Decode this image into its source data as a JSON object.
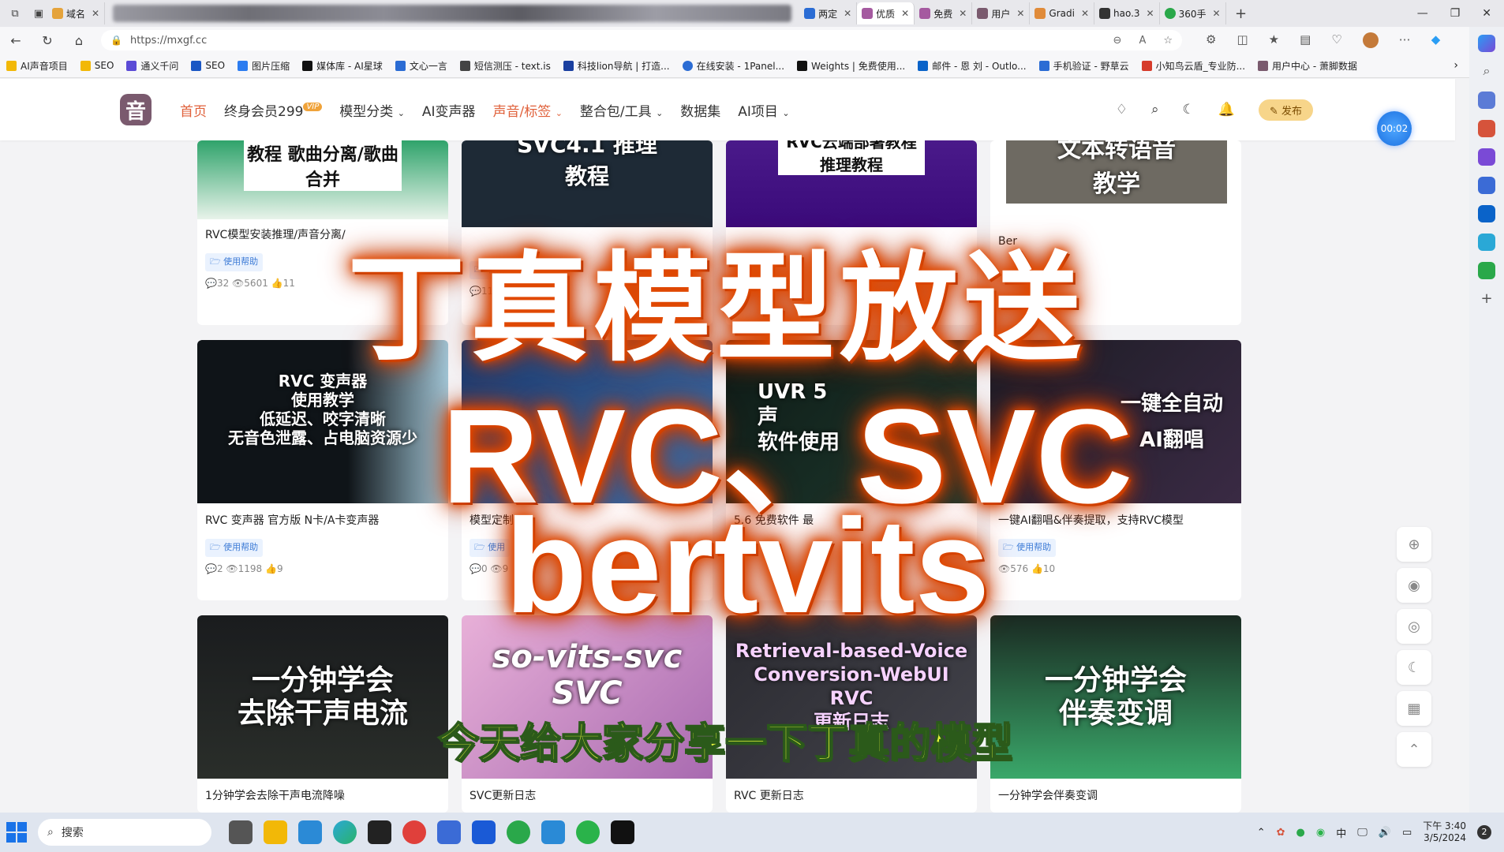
{
  "browser": {
    "tabs": [
      {
        "label": "域名",
        "color": "#e5a33b"
      },
      {
        "label": "两定",
        "color": "#2b6cd4"
      },
      {
        "label": "优质",
        "color": "#a55aa0",
        "active": true
      },
      {
        "label": "免费",
        "color": "#a55aa0"
      },
      {
        "label": "用户",
        "color": "#7a5a6e"
      },
      {
        "label": "Gradi",
        "color": "#e08b3a"
      },
      {
        "label": "hao.3",
        "color": "#333333"
      },
      {
        "label": "360手",
        "color": "#2aa84a"
      }
    ],
    "url": "https://mxgf.cc",
    "bookmarks": [
      {
        "label": "AI声音项目",
        "color": "#f2b807"
      },
      {
        "label": "SEO",
        "color": "#f2b807"
      },
      {
        "label": "通义千问",
        "color": "#5b4bd6"
      },
      {
        "label": "SEO",
        "color": "#1a57c4"
      },
      {
        "label": "图片压缩",
        "color": "#2c7cf0"
      },
      {
        "label": "媒体库 - AI星球",
        "color": "#111111"
      },
      {
        "label": "文心一言",
        "color": "#2b6cd4"
      },
      {
        "label": "短信测压 - text.is",
        "color": "#444444"
      },
      {
        "label": "科技lion导航 | 打造...",
        "color": "#1a3fa0"
      },
      {
        "label": "在线安装 - 1Panel...",
        "color": "#2b6cd4"
      },
      {
        "label": "Weights | 免费使用...",
        "color": "#111111"
      },
      {
        "label": "邮件 - 恩 刘 - Outlo...",
        "color": "#0a63c9"
      },
      {
        "label": "手机验证 - 野草云",
        "color": "#2b6cd4"
      },
      {
        "label": "小知鸟云盾_专业防...",
        "color": "#d63b2b"
      },
      {
        "label": "用户中心 - 萧脚数据",
        "color": "#7a5a6e"
      }
    ]
  },
  "site": {
    "logo": "音",
    "menu": [
      {
        "label": "首页",
        "active": true
      },
      {
        "label": "终身会员299",
        "badge": "VIP"
      },
      {
        "label": "模型分类",
        "dropdown": true
      },
      {
        "label": "AI变声器"
      },
      {
        "label": "声音/标签",
        "dropdown": true
      },
      {
        "label": "整合包/工具",
        "dropdown": true
      },
      {
        "label": "数据集"
      },
      {
        "label": "AI项目",
        "dropdown": true
      }
    ],
    "publish_label": "发布",
    "timer": "00:02"
  },
  "cards": [
    {
      "title": "RVC模型安装推理/声音分离/",
      "thumb_text": "教程\n歌曲分离/歌曲合并",
      "tag": "使用帮助",
      "comments": "32",
      "views": "5601",
      "likes": "11"
    },
    {
      "title": "",
      "thumb_text": "SVC4.1 推理\n教程",
      "tag": "使用",
      "comments": "11",
      "views": "",
      "likes": ""
    },
    {
      "title": "",
      "thumb_text": "RVC云端部署教程\n推理教程",
      "tag": "",
      "comments": "",
      "views": "",
      "likes": ""
    },
    {
      "title": "Ber",
      "thumb_text": "文本转语音\n教学",
      "tag": "",
      "comments": "",
      "views": "",
      "likes": ""
    },
    {
      "title": "RVC 变声器 官方版 N卡/A卡变声器",
      "thumb_text": "RVC 变声器\n使用教学\n低延迟、咬字清晰\n无音色泄露、占电脑资源少",
      "tag": "使用帮助",
      "comments": "2",
      "views": "1198",
      "likes": "9"
    },
    {
      "title": "模型定制",
      "thumb_text": "",
      "tag": "使用",
      "comments": "0",
      "views": "9",
      "likes": ""
    },
    {
      "title": "5.6 免费软件 最",
      "thumb_text": "UVR 5\n声\n软件使用",
      "tag": "",
      "comments": "",
      "views": "",
      "likes": ""
    },
    {
      "title": "一键AI翻唱&伴奏提取，支持RVC模型",
      "thumb_text": "一键全自动\nAI翻唱",
      "tag": "使用帮助",
      "comments": "",
      "views": "576",
      "likes": "10"
    },
    {
      "title": "1分钟学会去除干声电流降噪",
      "thumb_text": "一分钟学会\n去除干声电流",
      "tag": "",
      "comments": "",
      "views": "",
      "likes": ""
    },
    {
      "title": "SVC更新日志",
      "thumb_text": "so-vits-svc\nSVC",
      "tag": "",
      "comments": "",
      "views": "",
      "likes": ""
    },
    {
      "title": "RVC 更新日志",
      "thumb_text": "Retrieval-based-Voice\nConversion-WebUI\nRVC\n更新日志",
      "tag": "",
      "comments": "",
      "views": "",
      "likes": ""
    },
    {
      "title": "一分钟学会伴奏变调",
      "thumb_text": "一分钟学会\n伴奏变调",
      "tag": "",
      "comments": "",
      "views": "",
      "likes": ""
    }
  ],
  "overlay": {
    "line1": "丁真模型放送",
    "line2": "RVC、SVC",
    "line3": "bertvits",
    "subtitle": "今天给大家分享一下丁真的模型"
  },
  "taskbar": {
    "search_label": "搜索",
    "ime": "中",
    "time": "下午 3:40",
    "date": "3/5/2024",
    "notify_count": "2"
  }
}
